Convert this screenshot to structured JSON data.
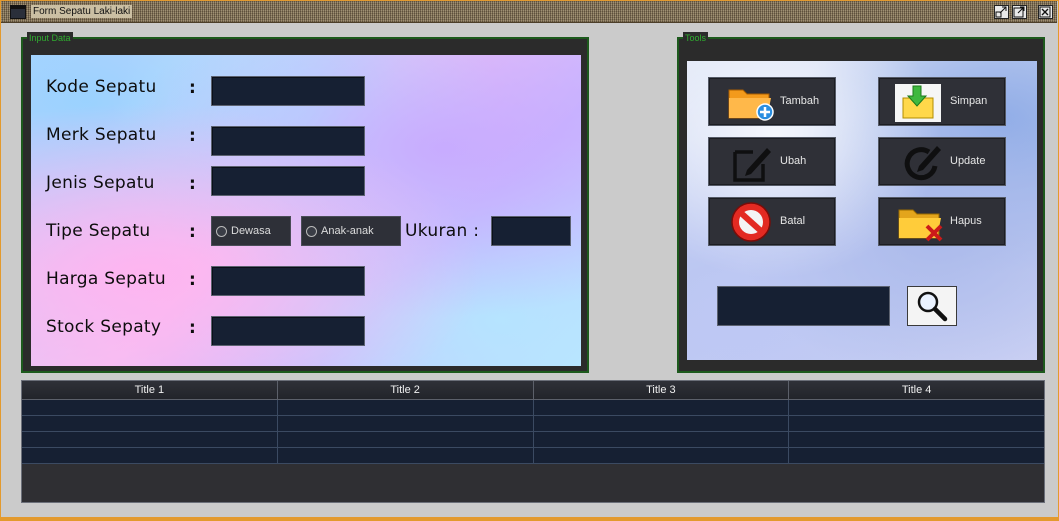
{
  "window": {
    "title": "Form Sepatu Laki-laki",
    "controls": [
      "minimize-icon",
      "maximize-icon",
      "close-icon"
    ]
  },
  "input_panel": {
    "title": "Input Data",
    "labels": {
      "kode": "Kode Sepatu",
      "merk": "Merk Sepatu",
      "jenis": "Jenis Sepatu",
      "tipe": "Tipe Sepatu",
      "harga": "Harga Sepatu",
      "stock": "Stock Sepaty",
      "ukuran": "Ukuran :"
    },
    "colon": ":",
    "fields": {
      "kode": "",
      "merk": "",
      "jenis": "",
      "harga": "",
      "stock": "",
      "ukuran": ""
    },
    "tipe_options": [
      "Dewasa",
      "Anak-anak"
    ]
  },
  "tools_panel": {
    "title": "Tools",
    "buttons": {
      "tambah": "Tambah",
      "simpan": "Simpan",
      "ubah": "Ubah",
      "update": "Update",
      "batal": "Batal",
      "hapus": "Hapus"
    },
    "search_value": ""
  },
  "table": {
    "columns": [
      "Title 1",
      "Title 2",
      "Title 3",
      "Title 4"
    ],
    "rows": [
      [
        "",
        "",
        "",
        ""
      ],
      [
        "",
        "",
        "",
        ""
      ],
      [
        "",
        "",
        "",
        ""
      ],
      [
        "",
        "",
        "",
        ""
      ]
    ]
  },
  "colors": {
    "panel_border": "#1d5a1d",
    "panel_title": "#2fae2f",
    "field_bg": "#162033",
    "window_border": "#e39a2e"
  }
}
